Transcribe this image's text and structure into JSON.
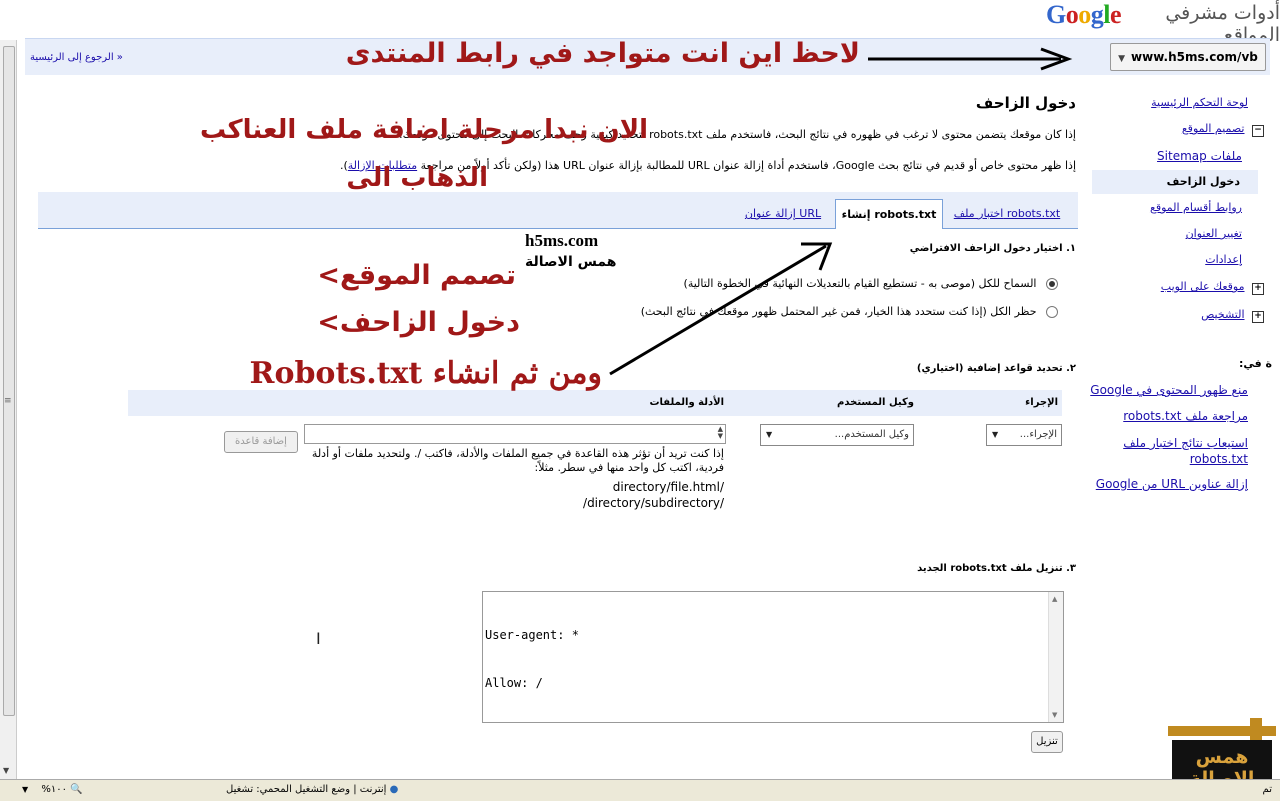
{
  "header": {
    "logo": "Google",
    "logo_subtitle": "أدوات مشرفي المواقع",
    "site_selector": "www.h5ms.com/vb",
    "back_link": "« الرجوع إلى الرئيسية"
  },
  "nav": {
    "items": [
      {
        "label": "لوحة التحكم الرئيسية"
      },
      {
        "label": "تصميم الموقع"
      },
      {
        "label": "ملفات Sitemap"
      },
      {
        "label": "دخول الزاحف"
      },
      {
        "label": "روابط أقسام الموقع"
      },
      {
        "label": "تغيير العنوان"
      },
      {
        "label": "إعدادات"
      },
      {
        "label": "موقعك على الويب"
      },
      {
        "label": "التشخيص"
      }
    ],
    "help_heading": "ة في:",
    "help_links": [
      {
        "label": "منع ظهور المحتوى في Google"
      },
      {
        "label": "مراجعة ملف robots.txt"
      },
      {
        "label": "استيعاب نتائج اختبار ملف robots.txt"
      },
      {
        "label": "إزالة عناوين URL من Google"
      }
    ]
  },
  "main": {
    "title": "دخول الزاحف",
    "intro1": "إذا كان موقعك يتضمن محتوى لا ترغب في ظهوره في نتائج البحث، فاستخدم ملف robots.txt لتحديد كيفية زحف محركات البحث إلى محتوى موقعك.",
    "intro2_pre": "إذا ظهر محتوى خاص أو قديم في نتائج بحث Google، فاستخدم أداة إزالة عنوان URL للمطالبة بإزالة عنوان URL هذا (ولكن تأكد أولاً من مراجعة",
    "intro2_link": "متطلبات الإزالة",
    "intro2_post": ").",
    "tabs": [
      {
        "label": "اختبار ملف robots.txt"
      },
      {
        "label": "إنشاء robots.txt"
      },
      {
        "label": "إزالة عنوان URL"
      }
    ],
    "section1": {
      "title": "١. اختيار دخول الزاحف الافتراضي",
      "opt_allow": "السماح للكل (موصى به - تستطيع القيام بالتعديلات النهائية في الخطوة التالية)",
      "opt_block": "حظر الكل (إذا كنت ستحدد هذا الخيار، فمن غير المحتمل ظهور موقعك في نتائج البحث)"
    },
    "section2": {
      "title": "٢. تحديد قواعد إضافية (اختياري)",
      "col_action": "الإجراء",
      "col_agent": "وكيل المستخدم",
      "col_dirs": "الأدلة والملفات",
      "action_select": "الإجراء...",
      "agent_select": "وكيل المستخدم...",
      "add_rule_button": "إضافة قاعدة",
      "hint": "إذا كنت تريد أن تؤثر هذه القاعدة في جميع الملفات والأدلة، فاكتب /. ولتحديد ملفات أو أدلة فردية، اكتب كل واحد منها في سطر. مثلاً:",
      "example1": "/directory/file.html",
      "example2": "/directory/subdirectory/"
    },
    "section3": {
      "title": "٣. تنزيل ملف robots.txt الجديد",
      "code_line1": "User-agent: *",
      "code_line2": "Allow: /",
      "download_button": "تنزيل"
    }
  },
  "annotations": {
    "top": "لاحظ اين انت متواجد في رابط المنتدى",
    "line1": "الان نبدا مرحلة اضافة ملف العناكب",
    "line2": "الذهاب الى",
    "step1": "تصمم الموقع>",
    "step2": "دخول الزاحف>",
    "step3": "ومن ثم انشاء Robots.txt",
    "brand_site": "h5ms.com",
    "brand_name": "همس الاصالة"
  },
  "statusbar": {
    "done": "تم",
    "zone": "إنترنت | وضع التشغيل المحمي: تشغيل",
    "zoom": "%١٠٠"
  },
  "watermark": {
    "text": "همس الاصالة"
  },
  "colors": {
    "annotation_red": "#a01818",
    "link_blue": "#1a0dab",
    "bar_blue": "#e8eefa"
  }
}
